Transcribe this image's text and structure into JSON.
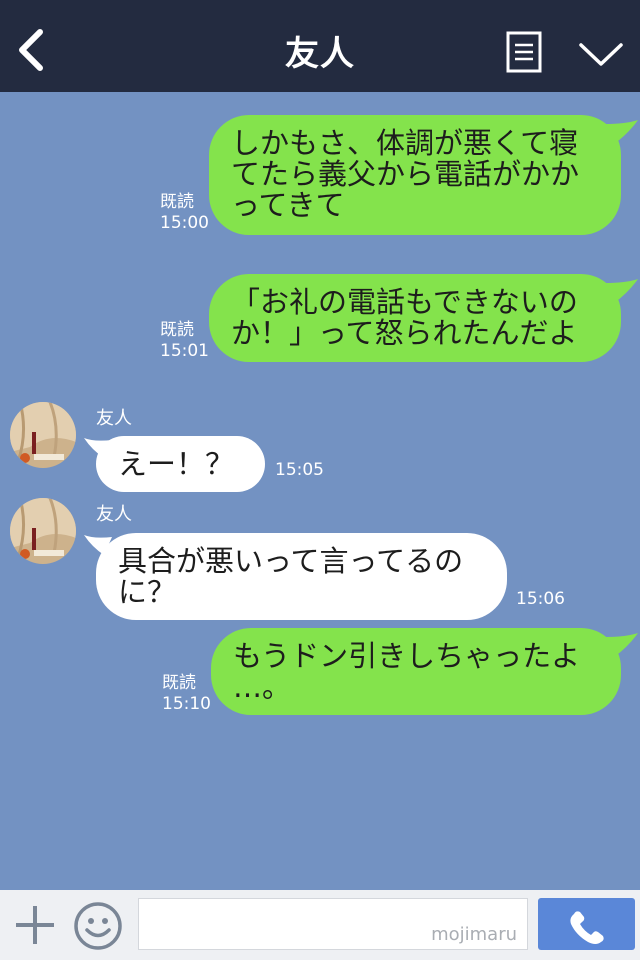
{
  "header": {
    "title": "友人"
  },
  "messages": [
    {
      "text_lines": [
        "しかもさ、体調が悪くて寝",
        "てたら義父から電話がかか",
        "ってきて"
      ],
      "read": "既読",
      "time": "15:00"
    },
    {
      "text_lines": [
        "「お礼の電話もできないの",
        "か！」って怒られたんだよ"
      ],
      "read": "既読",
      "time": "15:01"
    },
    {
      "sender": "友人",
      "text_lines": [
        "えー！？"
      ],
      "time": "15:05"
    },
    {
      "sender": "友人",
      "text_lines": [
        "具合が悪いって言ってるの",
        "に？"
      ],
      "time": "15:06"
    },
    {
      "text_lines": [
        "もうドン引きしちゃったよ",
        "…。"
      ],
      "read": "既読",
      "time": "15:10"
    }
  ],
  "input_bar": {
    "watermark": "mojimaru",
    "placeholder": ""
  },
  "colors": {
    "background": "#7392c2",
    "header": "#232b40",
    "my_bubble": "#84e34c",
    "their_bubble": "#ffffff",
    "call_button": "#5a87d8"
  },
  "icons": [
    "back-arrow-icon",
    "memo-icon",
    "chevron-down-icon",
    "plus-icon",
    "smiley-icon",
    "phone-icon"
  ]
}
